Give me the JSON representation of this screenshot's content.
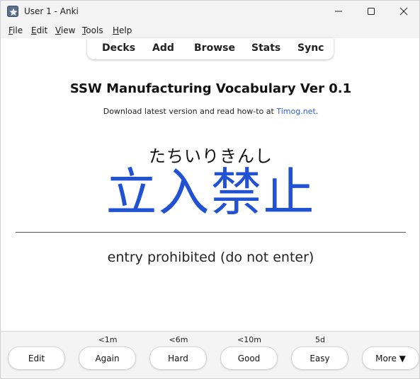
{
  "window": {
    "title": "User 1 - Anki",
    "icon": "anki-star-icon"
  },
  "menubar": {
    "items": [
      "File",
      "Edit",
      "View",
      "Tools",
      "Help"
    ]
  },
  "toolbar": {
    "decks": "Decks",
    "add": "Add",
    "browse": "Browse",
    "stats": "Stats",
    "sync": "Sync"
  },
  "card": {
    "title": "SSW Manufacturing Vocabulary Ver 0.1",
    "subtitle_prefix": "Download latest version and read how-to at ",
    "subtitle_link": "Timog.net",
    "subtitle_suffix": ".",
    "reading": "たちいりきんし",
    "kanji": "立入禁止",
    "meaning": "entry prohibited (do not enter)",
    "kanji_color": "#2152d4",
    "link_color": "#2f62d1"
  },
  "answer_bar": {
    "edit": "Edit",
    "more": "More ▼",
    "buttons": [
      {
        "label": "Again",
        "interval": "<1m"
      },
      {
        "label": "Hard",
        "interval": "<6m"
      },
      {
        "label": "Good",
        "interval": "<10m"
      },
      {
        "label": "Easy",
        "interval": "5d"
      }
    ]
  }
}
